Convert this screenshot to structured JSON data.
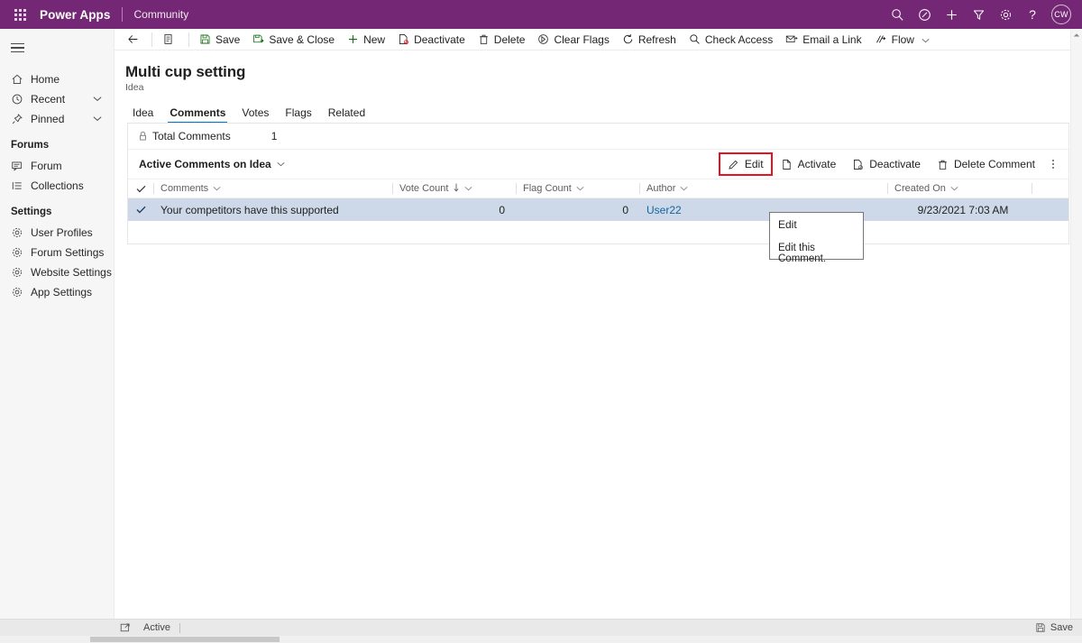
{
  "topbar": {
    "waffle_icon": "waffle-icon",
    "brand": "Power Apps",
    "app_name": "Community",
    "icons": [
      {
        "name": "search-icon",
        "label": "Search"
      },
      {
        "name": "assistant-icon",
        "label": "Assistant"
      },
      {
        "name": "add-icon",
        "label": "New"
      },
      {
        "name": "filter-icon",
        "label": "Filter"
      },
      {
        "name": "settings-gear-icon",
        "label": "Settings"
      },
      {
        "name": "help-icon",
        "label": "Help"
      }
    ],
    "avatar_initials": "CW"
  },
  "sidebar": {
    "hamburger_label": "Site Map",
    "items": [
      {
        "label": "Home",
        "icon": "home-icon",
        "chevron": false
      },
      {
        "label": "Recent",
        "icon": "clock-icon",
        "chevron": true
      },
      {
        "label": "Pinned",
        "icon": "pin-icon",
        "chevron": true
      }
    ],
    "groups": [
      {
        "title": "Forums",
        "items": [
          {
            "label": "Forum",
            "icon": "forum-icon"
          },
          {
            "label": "Collections",
            "icon": "collections-icon"
          }
        ]
      },
      {
        "title": "Settings",
        "items": [
          {
            "label": "User Profiles",
            "icon": "gear-icon"
          },
          {
            "label": "Forum Settings",
            "icon": "gear-icon"
          },
          {
            "label": "Website Settings",
            "icon": "gear-icon"
          },
          {
            "label": "App Settings",
            "icon": "gear-icon"
          }
        ]
      }
    ]
  },
  "command_bar": {
    "back_label": "Back",
    "form_icon_label": "Form selector",
    "buttons": [
      {
        "label": "Save",
        "icon": "save-icon"
      },
      {
        "label": "Save & Close",
        "icon": "save-close-icon"
      },
      {
        "label": "New",
        "icon": "plus-icon"
      },
      {
        "label": "Deactivate",
        "icon": "deactivate-icon"
      },
      {
        "label": "Delete",
        "icon": "trash-icon"
      },
      {
        "label": "Clear Flags",
        "icon": "clear-flags-icon"
      },
      {
        "label": "Refresh",
        "icon": "refresh-icon"
      },
      {
        "label": "Check Access",
        "icon": "check-access-icon"
      },
      {
        "label": "Email a Link",
        "icon": "email-link-icon"
      },
      {
        "label": "Flow",
        "icon": "flow-icon",
        "chevron": true
      }
    ]
  },
  "page": {
    "title": "Multi cup setting",
    "subtitle": "Idea",
    "tabs": [
      {
        "label": "Idea",
        "active": false
      },
      {
        "label": "Comments",
        "active": true
      },
      {
        "label": "Votes",
        "active": false
      },
      {
        "label": "Flags",
        "active": false
      },
      {
        "label": "Related",
        "active": false
      }
    ]
  },
  "subgrid": {
    "total_label": "Total Comments",
    "total_value": "1",
    "lock_icon": "lock-icon",
    "view_name": "Active Comments on Idea",
    "view_chevron_icon": "chevron-down-icon",
    "actions": [
      {
        "label": "Edit",
        "icon": "edit-pencil-icon",
        "highlighted": true
      },
      {
        "label": "Activate",
        "icon": "activate-icon",
        "highlighted": false
      },
      {
        "label": "Deactivate",
        "icon": "deactivate-icon",
        "highlighted": false
      },
      {
        "label": "Delete Comment",
        "icon": "trash-icon",
        "highlighted": false
      }
    ],
    "overflow_icon": "more-vertical-icon",
    "columns": [
      {
        "label": "Comments",
        "sorted": false
      },
      {
        "label": "Vote Count",
        "sorted": true
      },
      {
        "label": "Flag Count",
        "sorted": false
      },
      {
        "label": "Author",
        "sorted": false
      },
      {
        "label": "Created On",
        "sorted": false
      }
    ],
    "rows": [
      {
        "selected": true,
        "comment": "Your competitors have this supported",
        "vote_count": "0",
        "flag_count": "0",
        "author": "User22",
        "created_on": "9/23/2021 7:03 AM"
      }
    ]
  },
  "tooltip": {
    "title": "Edit",
    "body": "Edit this Comment."
  },
  "statusbar": {
    "expand_icon": "expand-icon",
    "state": "Active",
    "save_label": "Save",
    "save_icon": "save-icon"
  },
  "colors": {
    "brand_purple": "#742774",
    "accent_blue": "#0078d4",
    "highlight_red": "#e81123",
    "row_selected": "#cdd9e8",
    "link_blue": "#1264a3"
  }
}
